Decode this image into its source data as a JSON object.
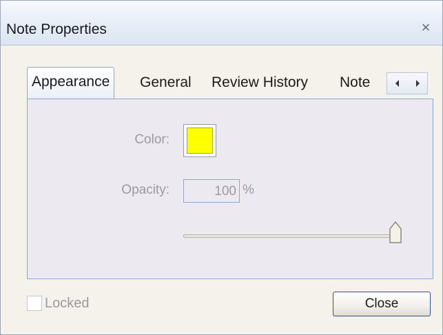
{
  "window": {
    "title": "Note Properties",
    "close_glyph": "×"
  },
  "tabs": [
    {
      "label": "Appearance",
      "active": true
    },
    {
      "label": "General",
      "active": false
    },
    {
      "label": "Review History",
      "active": false
    },
    {
      "label": "Note",
      "active": false
    }
  ],
  "tab_scroll": {
    "left_icon": "chevron-left-icon",
    "right_icon": "chevron-right-icon",
    "left_glyph": "◀",
    "right_glyph": "▶"
  },
  "appearance": {
    "color_label": "Color:",
    "color_value": "#ffff00",
    "opacity_label": "Opacity:",
    "opacity_value": "100",
    "opacity_unit": "%",
    "opacity_slider_level": 1.0
  },
  "footer": {
    "locked_label": "Locked",
    "locked_checked": false,
    "close_label": "Close"
  }
}
